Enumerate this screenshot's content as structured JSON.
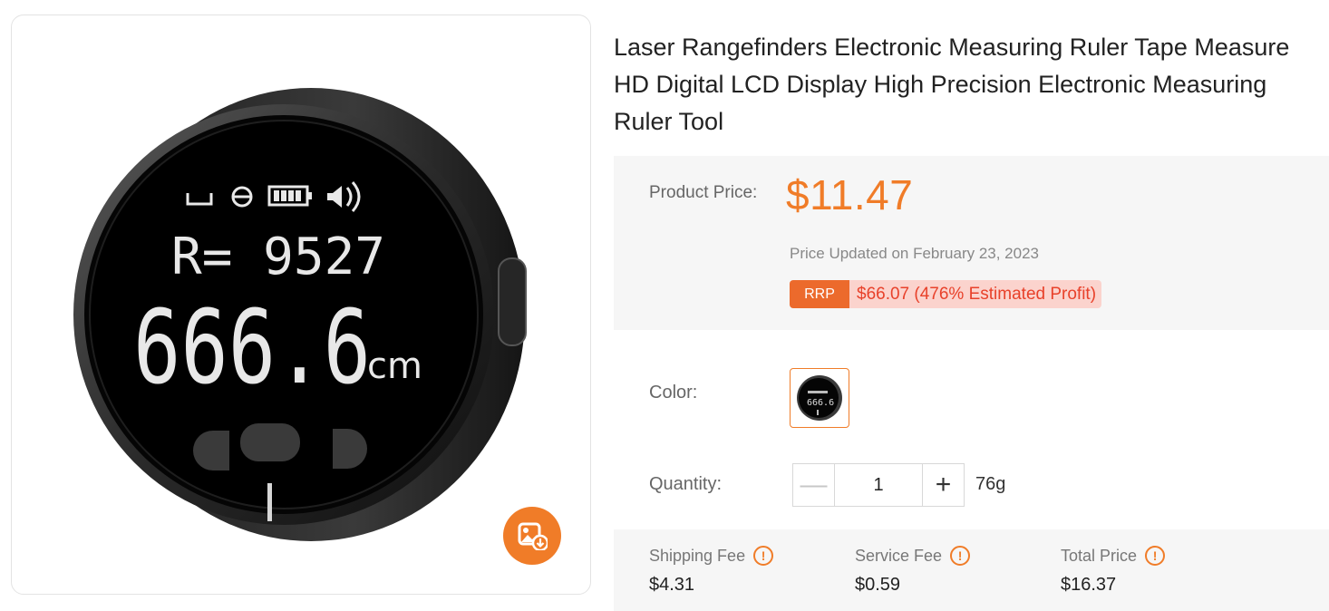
{
  "product": {
    "title": "Laser Rangefinders Electronic Measuring Ruler Tape Measure HD Digital LCD Display High Precision Electronic Measuring Ruler Tool",
    "image_icon": "save-image-icon",
    "display": {
      "reading_line": "R= 9527",
      "main_value": "666.6",
      "unit": "cm"
    }
  },
  "price": {
    "label": "Product Price:",
    "value": "$11.47",
    "updated": "Price Updated on February 23, 2023",
    "rrp_badge": "RRP",
    "rrp_text": "$66.07 (476% Estimated Profit)"
  },
  "color": {
    "label": "Color:",
    "selected_swatch_display": "666.6"
  },
  "quantity": {
    "label": "Quantity:",
    "value": "1",
    "minus": "—",
    "plus": "+",
    "weight": "76g"
  },
  "fees": [
    {
      "name": "Shipping Fee",
      "value": "$4.31"
    },
    {
      "name": "Service Fee",
      "value": "$0.59"
    },
    {
      "name": "Total Price",
      "value": "$16.37"
    }
  ],
  "colors": {
    "accent": "#f07c28",
    "rrp_badge": "#ec6a2c",
    "rrp_bg": "#fbd3cd",
    "rrp_text": "#e8412a"
  }
}
